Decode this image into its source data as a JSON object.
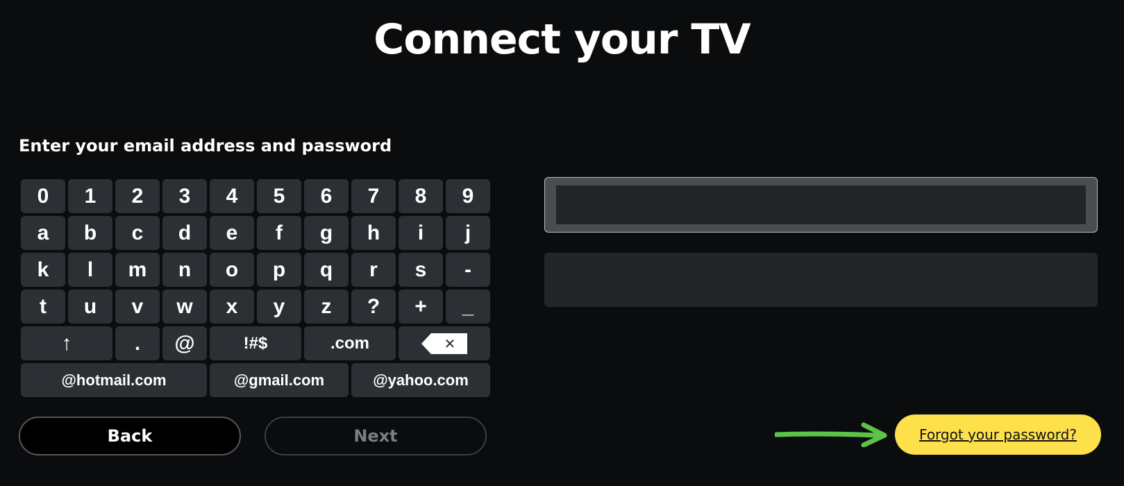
{
  "header": {
    "title": "Connect your TV"
  },
  "form": {
    "instruction": "Enter your email address and password",
    "email_value": "",
    "password_value": ""
  },
  "keyboard": {
    "rows": [
      [
        "0",
        "1",
        "2",
        "3",
        "4",
        "5",
        "6",
        "7",
        "8",
        "9"
      ],
      [
        "a",
        "b",
        "c",
        "d",
        "e",
        "f",
        "g",
        "h",
        "i",
        "j"
      ],
      [
        "k",
        "l",
        "m",
        "n",
        "o",
        "p",
        "q",
        "r",
        "s",
        "-"
      ],
      [
        "t",
        "u",
        "v",
        "w",
        "x",
        "y",
        "z",
        "?",
        "+",
        "_"
      ]
    ],
    "special": {
      "shift": "↑",
      "dot": ".",
      "at": "@",
      "symbols": "!#$",
      "dotcom": ".com",
      "backspace_glyph": "✕"
    },
    "domains": [
      "@hotmail.com",
      "@gmail.com",
      "@yahoo.com"
    ]
  },
  "buttons": {
    "back": "Back",
    "next": "Next",
    "forgot": "Forgot your password?"
  },
  "colors": {
    "background": "#0b0c0e",
    "key": "#2c3035",
    "accent_yellow": "#fde04a",
    "arrow_green": "#5dc24a"
  }
}
